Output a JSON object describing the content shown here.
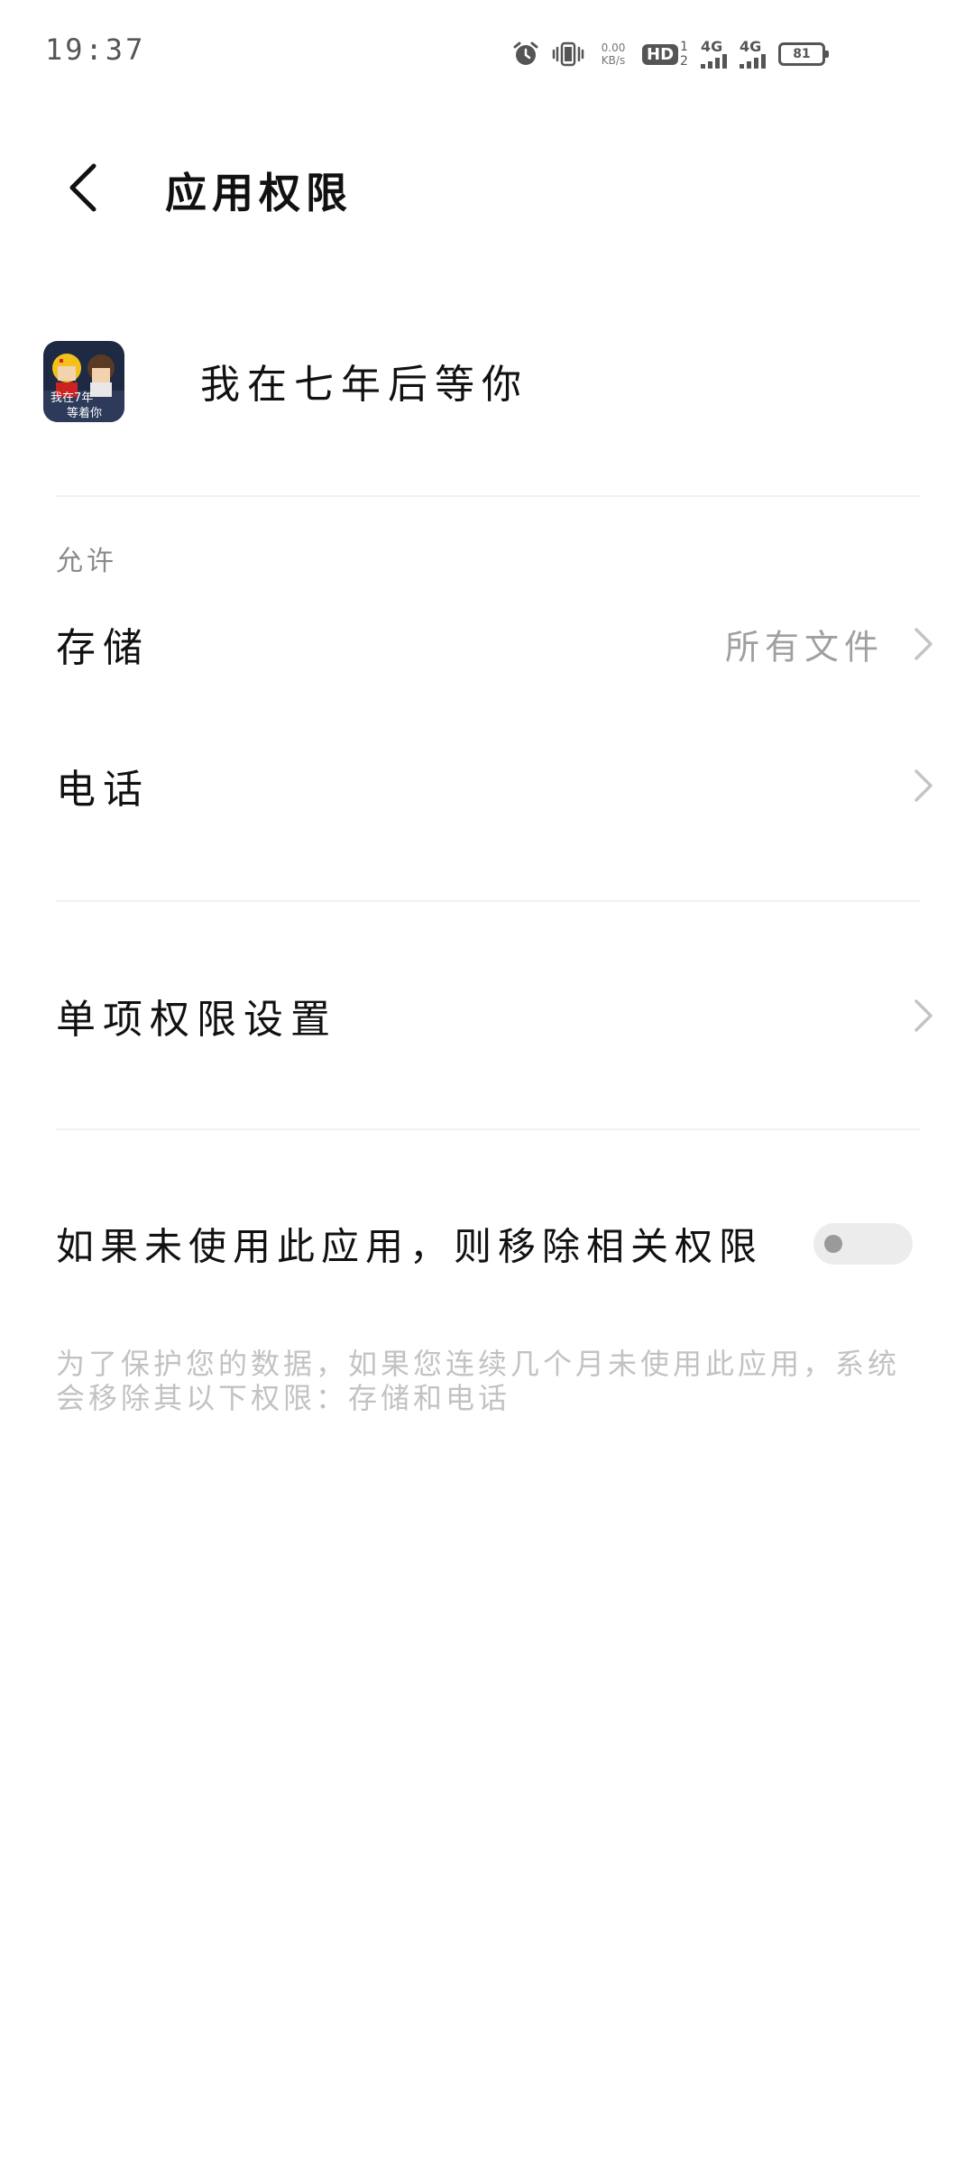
{
  "status_bar": {
    "time": "19:37",
    "net_speed_value": "0.00",
    "net_speed_unit": "KB/s",
    "hd_label": "HD",
    "hd_sub": "1\n2",
    "sim1_label": "4G",
    "sim2_label": "4G",
    "battery_level": "81",
    "icons": [
      "alarm-icon",
      "vibrate-icon",
      "signal-icon",
      "battery-icon"
    ]
  },
  "header": {
    "title": "应用权限",
    "back_icon": "chevron-left-icon"
  },
  "app": {
    "name": "我在七年后等你",
    "icon_text_top": "我在7年",
    "icon_text_bottom": "等着你"
  },
  "permissions": {
    "section_label": "允许",
    "items": [
      {
        "label": "存储",
        "value": "所有文件"
      },
      {
        "label": "电话",
        "value": ""
      }
    ]
  },
  "individual_settings": {
    "label": "单项权限设置"
  },
  "auto_revoke": {
    "label": "如果未使用此应用，则移除相关权限",
    "enabled": false,
    "note": "为了保护您的数据，如果您连续几个月未使用此应用，系统会移除其以下权限：存储和电话"
  },
  "colors": {
    "background": "#ffffff",
    "primary_text": "#111111",
    "secondary_text": "#8a8a8a",
    "hint_text": "#c2c2c2",
    "toggle_off": "#ececec"
  }
}
